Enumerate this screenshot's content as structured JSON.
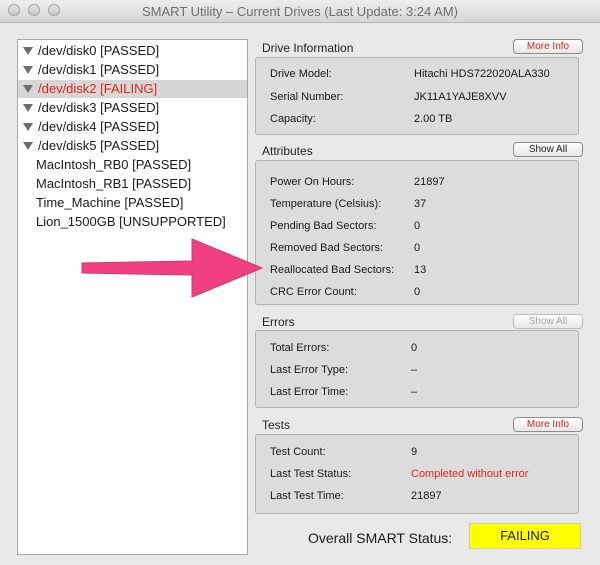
{
  "window": {
    "title": "SMART Utility – Current Drives (Last Update: 3:24 AM)"
  },
  "drives": [
    {
      "label": "/dev/disk0  [PASSED]",
      "expanded": true,
      "status": "passed"
    },
    {
      "label": "/dev/disk1  [PASSED]",
      "expanded": true,
      "status": "passed"
    },
    {
      "label": "/dev/disk2  [FAILING]",
      "expanded": true,
      "status": "failing",
      "selected": true
    },
    {
      "label": "/dev/disk3  [PASSED]",
      "expanded": true,
      "status": "passed"
    },
    {
      "label": "/dev/disk4  [PASSED]",
      "expanded": true,
      "status": "passed"
    },
    {
      "label": "/dev/disk5  [PASSED]",
      "expanded": true,
      "status": "passed"
    },
    {
      "label": "MacIntosh_RB0  [PASSED]",
      "status": "passed"
    },
    {
      "label": "MacIntosh_RB1  [PASSED]",
      "status": "passed"
    },
    {
      "label": "Time_Machine  [PASSED]",
      "status": "passed"
    },
    {
      "label": "Lion_1500GB  [UNSUPPORTED]",
      "status": "unsupported"
    }
  ],
  "drive_info": {
    "heading": "Drive Information",
    "button": "More Info",
    "fields": [
      {
        "label": "Drive Model:",
        "value": "Hitachi HDS722020ALA330"
      },
      {
        "label": "Serial Number:",
        "value": "JK11A1YAJE8XVV"
      },
      {
        "label": "Capacity:",
        "value": "2.00 TB"
      }
    ]
  },
  "attributes": {
    "heading": "Attributes",
    "button": "Show All",
    "fields": [
      {
        "label": "Power On Hours:",
        "value": "21897"
      },
      {
        "label": "Temperature (Celsius):",
        "value": "37"
      },
      {
        "label": "Pending Bad Sectors:",
        "value": "0"
      },
      {
        "label": "Removed Bad Sectors:",
        "value": "0"
      },
      {
        "label": "Reallocated Bad Sectors:",
        "value": "13"
      },
      {
        "label": "CRC Error Count:",
        "value": "0"
      }
    ]
  },
  "errors": {
    "heading": "Errors",
    "button": "Show All",
    "fields": [
      {
        "label": "Total Errors:",
        "value": "0"
      },
      {
        "label": "Last Error Type:",
        "value": "–"
      },
      {
        "label": "Last Error Time:",
        "value": "–"
      }
    ]
  },
  "tests": {
    "heading": "Tests",
    "button": "More Info",
    "fields": [
      {
        "label": "Test Count:",
        "value": "9"
      },
      {
        "label": "Last Test Status:",
        "value": "Completed without error"
      },
      {
        "label": "Last Test Time:",
        "value": "21897"
      }
    ]
  },
  "overall": {
    "label": "Overall SMART Status:",
    "status": "FAILING"
  },
  "colors": {
    "failing_text": "#e0261a",
    "status_badge": "#ffff00",
    "annotation_arrow": "#f0407f"
  }
}
